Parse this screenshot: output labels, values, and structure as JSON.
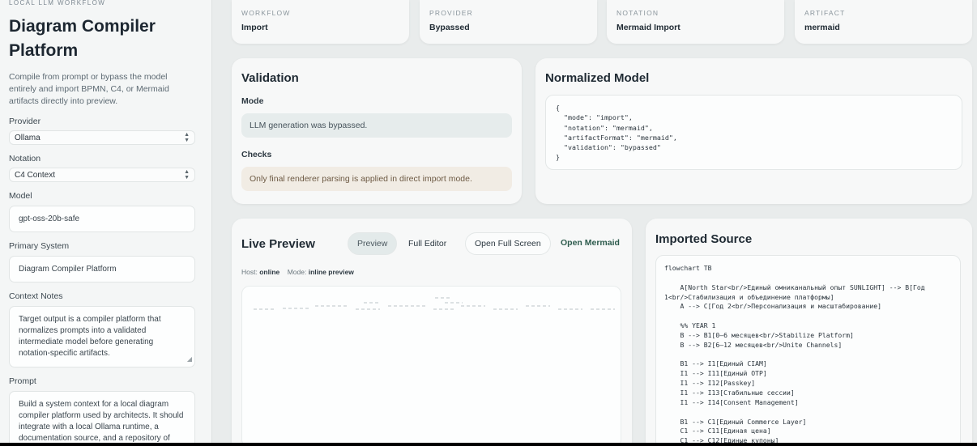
{
  "sidebar": {
    "eyebrow": "LOCAL LLM WORKFLOW",
    "title_line1": "Diagram Compiler",
    "title_line2": "Platform",
    "description": "Compile from prompt or bypass the model entirely and import BPMN, C4, or Mermaid artifacts directly into preview.",
    "provider_label": "Provider",
    "provider_value": "Ollama",
    "notation_label": "Notation",
    "notation_value": "C4 Context",
    "model_label": "Model",
    "model_value": "gpt-oss-20b-safe",
    "primary_label": "Primary System",
    "primary_value": "Diagram Compiler Platform",
    "context_label": "Context Notes",
    "context_value": "Target output is a compiler platform that normalizes prompts into a validated intermediate model before generating notation-specific artifacts.",
    "prompt_label": "Prompt",
    "prompt_value": "Build a system context for a local diagram compiler platform used by architects. It should integrate with a local Ollama runtime, a documentation source, and a repository of"
  },
  "stats": [
    {
      "key": "WORKFLOW",
      "value": "Import"
    },
    {
      "key": "PROVIDER",
      "value": "Bypassed"
    },
    {
      "key": "NOTATION",
      "value": "Mermaid Import"
    },
    {
      "key": "ARTIFACT",
      "value": "mermaid"
    }
  ],
  "validation": {
    "title": "Validation",
    "mode_label": "Mode",
    "mode_msg": "LLM generation was bypassed.",
    "checks_label": "Checks",
    "checks_msg": "Only final renderer parsing is applied in direct import mode."
  },
  "normalized": {
    "title": "Normalized Model",
    "code": "{\n  \"mode\": \"import\",\n  \"notation\": \"mermaid\",\n  \"artifactFormat\": \"mermaid\",\n  \"validation\": \"bypassed\"\n}"
  },
  "live": {
    "title": "Live Preview",
    "btn_preview": "Preview",
    "btn_editor": "Full Editor",
    "btn_fullscreen": "Open Full Screen",
    "link_mermaid": "Open Mermaid",
    "host_label": "Host:",
    "host_value": "online",
    "mode_label": "Mode:",
    "mode_value": "inline preview"
  },
  "imported": {
    "title": "Imported Source",
    "code": "flowchart TB\n\n    A[North Star<br/>Единый омниканальный опыт SUNLIGHT] --> B[Год\n1<br/>Стабилизация и объединение платформы]\n    A --> C[Год 2<br/>Персонализация и масштабирование]\n\n    %% YEAR 1\n    B --> B1[0–6 месяцев<br/>Stabilize Platform]\n    B --> B2[6–12 месяцев<br/>Unite Channels]\n\n    B1 --> I1[Единый CIAM]\n    I1 --> I11[Единый OTP]\n    I1 --> I12[Passkey]\n    I1 --> I13[Стабильные сессии]\n    I1 --> I14[Consent Management]\n\n    B1 --> C1[Единый Commerce Layer]\n    C1 --> C11[Единая цена]\n    C1 --> C12[Единые купоны]"
  }
}
